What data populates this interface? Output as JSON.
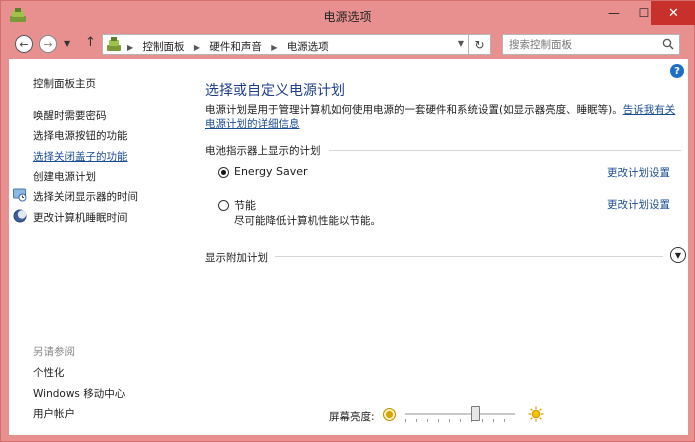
{
  "window": {
    "title": "电源选项",
    "controls": {
      "minimize": "—",
      "maximize": "☐",
      "close": "✕"
    }
  },
  "navbar": {
    "back_icon": "back-arrow-icon",
    "forward_icon": "forward-arrow-icon",
    "up_icon": "up-arrow-icon",
    "breadcrumbs": [
      "控制面板",
      "硬件和声音",
      "电源选项"
    ],
    "search_placeholder": "搜索控制面板"
  },
  "sidebar": {
    "home": "控制面板主页",
    "links": [
      "唤醒时需要密码",
      "选择电源按钮的功能",
      "选择关闭盖子的功能",
      "创建电源计划",
      "选择关闭显示器的时间",
      "更改计算机睡眠时间"
    ],
    "see_also_label": "另请参阅",
    "see_also": [
      "个性化",
      "Windows 移动中心",
      "用户帐户"
    ]
  },
  "main": {
    "title": "选择或自定义电源计划",
    "description": "电源计划是用于管理计算机如何使用电源的一套硬件和系统设置(如显示器亮度、睡眠等)。",
    "description_link": "告诉我有关电源计划的详细信息",
    "battery_meter_header": "电池指示器上显示的计划",
    "plans": [
      {
        "name": "Energy Saver",
        "description": "",
        "selected": true,
        "change_link": "更改计划设置"
      },
      {
        "name": "节能",
        "description": "尽可能降低计算机性能以节能。",
        "selected": false,
        "change_link": "更改计划设置"
      }
    ],
    "additional_plans": "显示附加计划"
  },
  "brightness": {
    "label": "屏幕亮度:",
    "level_percent": 64
  },
  "colors": {
    "window_frame": "#e8908f",
    "close_button": "#c7302b",
    "link": "#1a4c94",
    "title": "#1d3f8a"
  }
}
